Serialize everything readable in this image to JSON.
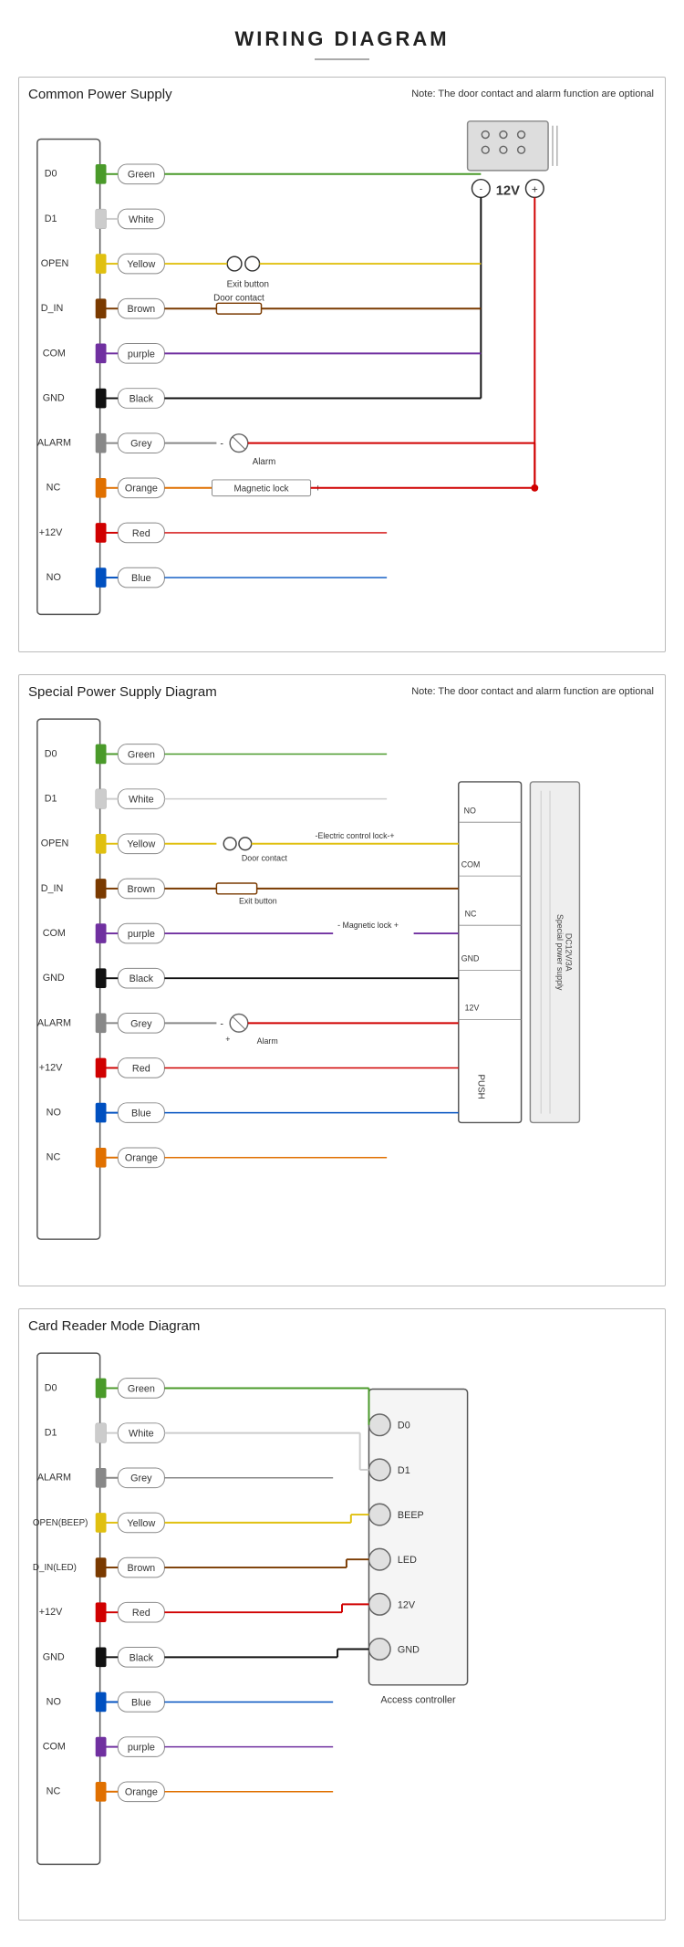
{
  "page": {
    "title": "WIRING DIAGRAM"
  },
  "diagram1": {
    "label": "Common Power Supply",
    "note": "Note: The door contact and alarm function are optional",
    "terminals": [
      "D0",
      "D1",
      "OPEN",
      "D_IN",
      "COM",
      "GND",
      "ALARM",
      "NC",
      "+12V",
      "NO"
    ],
    "wires": [
      {
        "label": "Green",
        "color": "#4a9a2a"
      },
      {
        "label": "White",
        "color": "#ccc"
      },
      {
        "label": "Yellow",
        "color": "#e0c010"
      },
      {
        "label": "Brown",
        "color": "#7a3a00"
      },
      {
        "label": "purple",
        "color": "#7030a0"
      },
      {
        "label": "Black",
        "color": "#111"
      },
      {
        "label": "Grey",
        "color": "#888"
      },
      {
        "label": "Orange",
        "color": "#e07000"
      },
      {
        "label": "Red",
        "color": "#d00000"
      },
      {
        "label": "Blue",
        "color": "#0050c0"
      }
    ]
  },
  "diagram2": {
    "label": "Special Power Supply Diagram",
    "note": "Note: The door contact and alarm function are optional",
    "terminals": [
      "D0",
      "D1",
      "OPEN",
      "D_IN",
      "COM",
      "GND",
      "ALARM",
      "+12V",
      "NO",
      "NC"
    ],
    "wires": [
      {
        "label": "Green",
        "color": "#4a9a2a"
      },
      {
        "label": "White",
        "color": "#ccc"
      },
      {
        "label": "Yellow",
        "color": "#e0c010"
      },
      {
        "label": "Brown",
        "color": "#7a3a00"
      },
      {
        "label": "purple",
        "color": "#7030a0"
      },
      {
        "label": "Black",
        "color": "#111"
      },
      {
        "label": "Grey",
        "color": "#888"
      },
      {
        "label": "Red",
        "color": "#d00000"
      },
      {
        "label": "Blue",
        "color": "#0050c0"
      },
      {
        "label": "Orange",
        "color": "#e07000"
      }
    ]
  },
  "diagram3": {
    "label": "Card Reader Mode Diagram",
    "terminals": [
      "D0",
      "D1",
      "ALARM",
      "OPEN(BEEP)",
      "D_IN(LED)",
      "+12V",
      "GND",
      "NO",
      "COM",
      "NC"
    ],
    "wires": [
      {
        "label": "Green",
        "color": "#4a9a2a"
      },
      {
        "label": "White",
        "color": "#ccc"
      },
      {
        "label": "Grey",
        "color": "#888"
      },
      {
        "label": "Yellow",
        "color": "#e0c010"
      },
      {
        "label": "Brown",
        "color": "#7a3a00"
      },
      {
        "label": "Red",
        "color": "#d00000"
      },
      {
        "label": "Black",
        "color": "#111"
      },
      {
        "label": "Blue",
        "color": "#0050c0"
      },
      {
        "label": "purple",
        "color": "#7030a0"
      },
      {
        "label": "Orange",
        "color": "#e07000"
      }
    ],
    "controller_labels": [
      "D0",
      "D1",
      "BEEP",
      "LED",
      "12V",
      "GND"
    ],
    "controller_title": "Access controller"
  }
}
